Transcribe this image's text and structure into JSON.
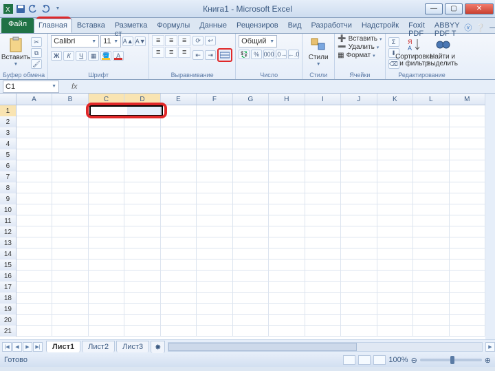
{
  "title": "Книга1 - Microsoft Excel",
  "tabs": {
    "file": "Файл",
    "home": "Главная",
    "insert": "Вставка",
    "pagelayout": "Разметка ст",
    "formulas": "Формулы",
    "data": "Данные",
    "review": "Рецензиров",
    "view": "Вид",
    "developer": "Разработчи",
    "addins": "Надстройк",
    "foxit": "Foxit PDF",
    "abbyy": "ABBYY PDF T"
  },
  "ribbon": {
    "clipboard": {
      "paste": "Вставить",
      "label": "Буфер обмена"
    },
    "font": {
      "name": "Calibri",
      "size": "11",
      "label": "Шрифт",
      "bold": "Ж",
      "italic": "К",
      "underline": "Ч"
    },
    "align": {
      "label": "Выравнивание"
    },
    "number": {
      "format": "Общий",
      "label": "Число",
      "percent": "%",
      "thousand": "000"
    },
    "styles": {
      "label": "Стили",
      "btn": "Стили"
    },
    "cells": {
      "insert": "Вставить",
      "delete": "Удалить",
      "format": "Формат",
      "label": "Ячейки"
    },
    "editing": {
      "sort": "Сортировка и фильтр",
      "find": "Найти и выделить",
      "label": "Редактирование"
    }
  },
  "namebox": "C1",
  "fx": "fx",
  "columns": [
    "A",
    "B",
    "C",
    "D",
    "E",
    "F",
    "G",
    "H",
    "I",
    "J",
    "K",
    "L",
    "M"
  ],
  "rows": [
    1,
    2,
    3,
    4,
    5,
    6,
    7,
    8,
    9,
    10,
    11,
    12,
    13,
    14,
    15,
    16,
    17,
    18,
    19,
    20,
    21
  ],
  "sheets": {
    "s1": "Лист1",
    "s2": "Лист2",
    "s3": "Лист3"
  },
  "status": {
    "ready": "Готово",
    "zoom": "100%"
  }
}
